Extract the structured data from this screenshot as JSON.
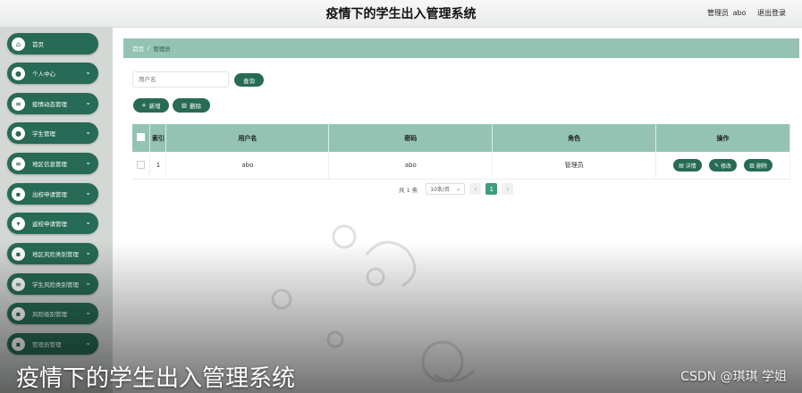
{
  "header": {
    "title": "疫情下的学生出入管理系统",
    "role": "管理员",
    "username": "abo",
    "logout": "退出登录"
  },
  "sidebar": {
    "items": [
      {
        "label": "首页",
        "icon": "home-icon",
        "has_chevron": false
      },
      {
        "label": "个人中心",
        "icon": "person-icon",
        "has_chevron": true
      },
      {
        "label": "疫情动态管理",
        "icon": "list-icon",
        "has_chevron": true
      },
      {
        "label": "学生管理",
        "icon": "person-icon",
        "has_chevron": true
      },
      {
        "label": "地区信息管理",
        "icon": "list-icon",
        "has_chevron": true
      },
      {
        "label": "出校申请管理",
        "icon": "grid-icon",
        "has_chevron": true
      },
      {
        "label": "返校申请管理",
        "icon": "shield-icon",
        "has_chevron": true
      },
      {
        "label": "地区风险类别管理",
        "icon": "grid-icon",
        "has_chevron": true
      },
      {
        "label": "学生风险类别管理",
        "icon": "list-icon",
        "has_chevron": true
      },
      {
        "label": "风险级别管理",
        "icon": "grid-icon",
        "has_chevron": true
      },
      {
        "label": "管理员管理",
        "icon": "grid-icon",
        "has_chevron": true
      }
    ]
  },
  "breadcrumb": {
    "home": "首页",
    "separator": "/",
    "current": "管理员"
  },
  "search": {
    "placeholder": "用户名",
    "query_button": "查询"
  },
  "toolbar": {
    "add": "新增",
    "delete": "删除"
  },
  "table": {
    "columns": [
      "索引",
      "用户名",
      "密码",
      "角色",
      "操作"
    ],
    "rows": [
      {
        "index": "1",
        "username": "abo",
        "password": "abo",
        "role": "管理员"
      }
    ],
    "ops": {
      "detail": "详情",
      "edit": "修改",
      "delete": "删除"
    }
  },
  "pagination": {
    "total": "共 1 条",
    "page_size": "10条/页",
    "prev": "‹",
    "current": "1",
    "next": "›"
  },
  "overlay": {
    "caption": "疫情下的学生出入管理系统",
    "credit": "CSDN @琪琪 学姐"
  },
  "colors": {
    "primary": "#276a55",
    "header_row": "#94c3b4",
    "sidebar_bg": "#d4d8d5"
  }
}
